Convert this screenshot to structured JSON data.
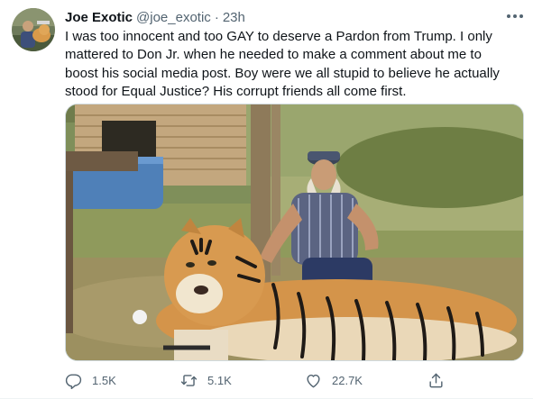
{
  "author": {
    "display_name": "Joe Exotic",
    "handle": "@joe_exotic",
    "separator": "·",
    "time_ago": "23h"
  },
  "tweet_text": "I was too innocent and too GAY to deserve a Pardon from Trump. I only mattered to Don Jr. when he needed to make a comment about me to boost his social media post. Boy were we all stupid to believe he actually stood for Equal Justice? His corrupt friends all come first.",
  "actions": {
    "reply_count": "1.5K",
    "retweet_count": "5.1K",
    "like_count": "22.7K"
  },
  "icons": {
    "more": "more-horizontal-icon",
    "reply": "reply-icon",
    "retweet": "retweet-icon",
    "like": "heart-icon",
    "share": "share-icon"
  },
  "colors": {
    "secondary_text": "#536471",
    "primary_text": "#0f1419",
    "border": "#cfd9de"
  }
}
